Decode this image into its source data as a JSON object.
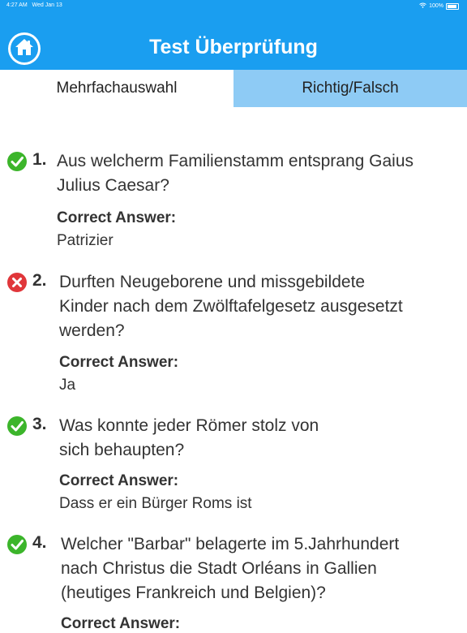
{
  "status_bar": {
    "time": "4:27 AM",
    "date": "Wed Jan 13",
    "battery": "100%"
  },
  "header": {
    "title": "Test Überprüfung"
  },
  "tabs": [
    {
      "label": "Mehrfachauswahl"
    },
    {
      "label": "Richtig/Falsch"
    }
  ],
  "questions": [
    {
      "number": "1.",
      "line1": "Aus welcherm Familienstamm entsprang Gaius",
      "line2": "Julius Caesar?",
      "line3": "",
      "answer_label": "Correct Answer:",
      "answer": "Patrizier",
      "status": "correct"
    },
    {
      "number": "2.",
      "line1": "Durften Neugeborene und missgebildete",
      "line2": "Kinder nach dem Zwölftafelgesetz ausgesetzt",
      "line3": "werden?",
      "answer_label": "Correct Answer:",
      "answer": "Ja",
      "status": "incorrect"
    },
    {
      "number": "3.",
      "line1": "Was konnte jeder Römer stolz von",
      "line2": "sich behaupten?",
      "line3": "",
      "answer_label": "Correct Answer:",
      "answer": "Dass er ein Bürger Roms ist",
      "status": "correct"
    },
    {
      "number": "4.",
      "line1": "Welcher \"Barbar\" belagerte im 5.Jahrhundert",
      "line2": "nach Christus die Stadt Orléans in Gallien",
      "line3": "(heutiges Frankreich und Belgien)?",
      "answer_label": "Correct Answer:",
      "answer": "",
      "status": "correct"
    }
  ],
  "colors": {
    "header": "#1a9ef0",
    "tab_active": "#ffffff",
    "tab_inactive": "#8ecbf5",
    "correct": "#3cb52b",
    "incorrect": "#e0363a"
  }
}
